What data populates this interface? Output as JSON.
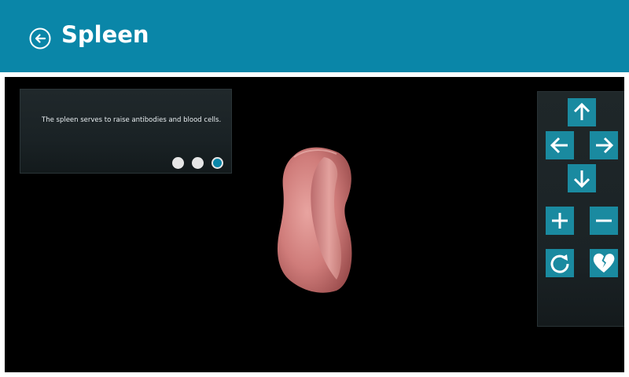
{
  "header": {
    "title": "Spleen",
    "back_icon": "back-arrow-circle-icon"
  },
  "info_panel": {
    "text": "The spleen serves to raise antibodies and blood cells.",
    "pager": {
      "total": 3,
      "current": 3
    }
  },
  "controls": [
    {
      "name": "move-up-button",
      "icon": "arrow-up-icon"
    },
    {
      "name": "move-left-button",
      "icon": "arrow-left-icon"
    },
    {
      "name": "move-right-button",
      "icon": "arrow-right-icon"
    },
    {
      "name": "move-down-button",
      "icon": "arrow-down-icon"
    },
    {
      "name": "zoom-in-button",
      "icon": "plus-icon"
    },
    {
      "name": "zoom-out-button",
      "icon": "minus-icon"
    },
    {
      "name": "rotate-button",
      "icon": "rotate-icon"
    },
    {
      "name": "dissect-button",
      "icon": "broken-heart-icon"
    }
  ],
  "colors": {
    "header": "#0a86a8",
    "control_button": "#1a8aa0",
    "viewport": "#000000",
    "dot_active": "#0a86a8",
    "dot_inactive": "#e6e6e6"
  }
}
